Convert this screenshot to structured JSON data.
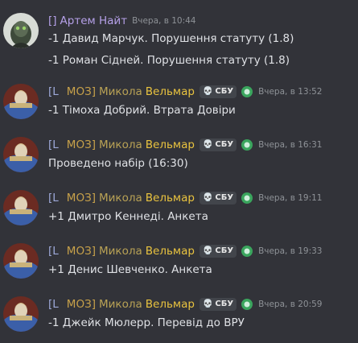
{
  "messages": [
    {
      "author_bracket": "[]",
      "author_name": "Артем Найт",
      "timestamp": "Вчера, в 10:44",
      "lines": [
        "-1 Давид Марчук. Порушення статуту (1.8)",
        "-1 Роман Сідней. Порушення статуту (1.8)"
      ]
    },
    {
      "author_bracket_open": "[L",
      "author_org": "МОЗ]",
      "author_first": "Микола",
      "author_last": "Вельмар",
      "role_tag": "СБУ",
      "timestamp": "Вчера, в 13:52",
      "lines": [
        "-1 Тімоха Добрий. Втрата Довіри"
      ]
    },
    {
      "author_bracket_open": "[L",
      "author_org": "МОЗ]",
      "author_first": "Микола",
      "author_last": "Вельмар",
      "role_tag": "СБУ",
      "timestamp": "Вчера, в 16:31",
      "lines": [
        "Проведено набір (16:30)"
      ]
    },
    {
      "author_bracket_open": "[L",
      "author_org": "МОЗ]",
      "author_first": "Микола",
      "author_last": "Вельмар",
      "role_tag": "СБУ",
      "timestamp": "Вчера, в 19:11",
      "lines": [
        "+1 Дмитро Кеннеді. Анкета"
      ]
    },
    {
      "author_bracket_open": "[L",
      "author_org": "МОЗ]",
      "author_first": "Микола",
      "author_last": "Вельмар",
      "role_tag": "СБУ",
      "timestamp": "Вчера, в 19:33",
      "lines": [
        "+1 Денис Шевченко. Анкета"
      ]
    },
    {
      "author_bracket_open": "[L",
      "author_org": "МОЗ]",
      "author_first": "Микола",
      "author_last": "Вельмар",
      "role_tag": "СБУ",
      "timestamp": "Вчера, в 20:59",
      "lines": [
        "-1 Джейк Мюлерр. Перевід до ВРУ"
      ]
    }
  ],
  "icons": {
    "avatar_artem": "green-alien-avatar",
    "avatar_mykola": "knight-avatar",
    "role_icon": "skull-icon",
    "badge": "green-server-badge-icon"
  },
  "colors": {
    "background": "#323339",
    "text": "#dfe1e5",
    "timestamp": "#8e9297",
    "name_gold": "#e9c33f",
    "name_purple": "#b5a0e8"
  }
}
